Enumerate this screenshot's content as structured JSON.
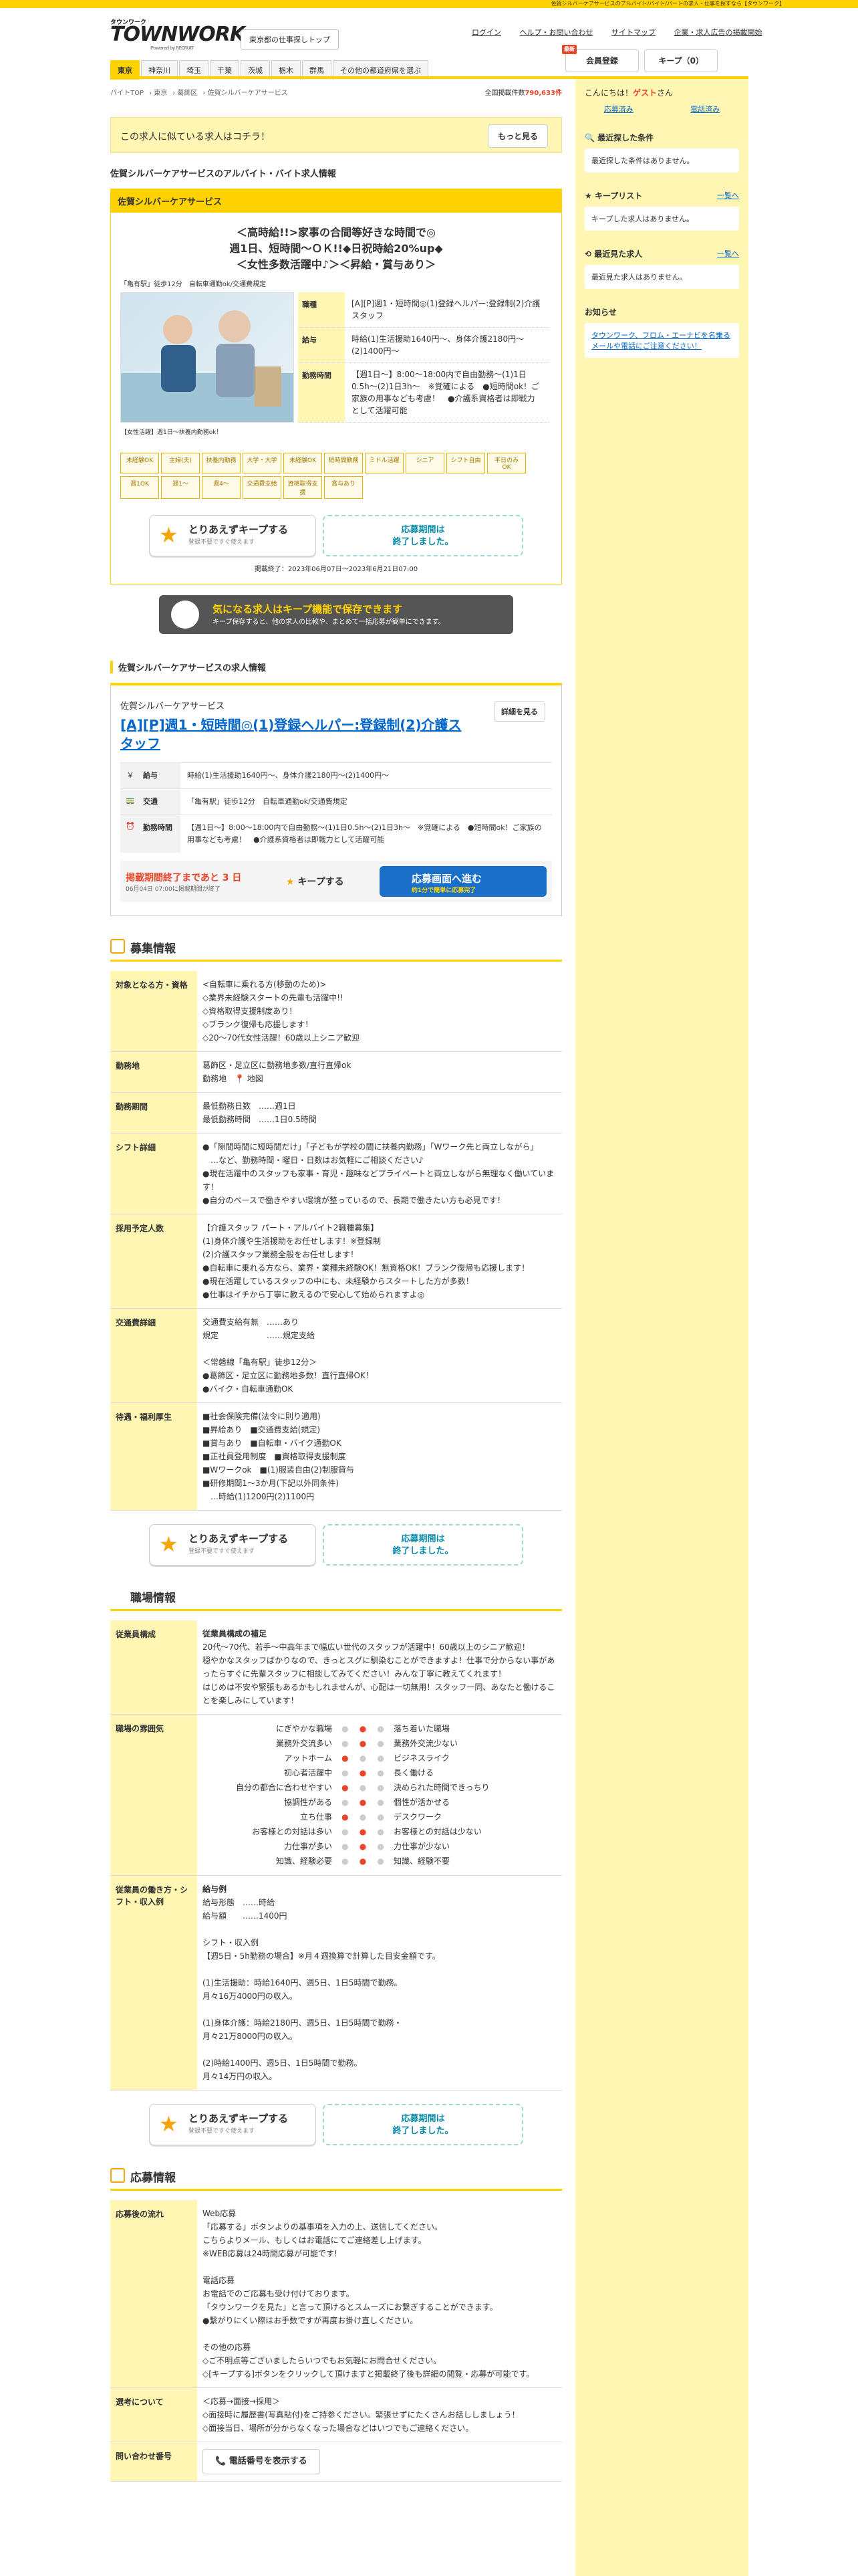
{
  "topbar": {
    "text": "佐賀シルバーケアサービスのアルバイト/バイト/パートの求人・仕事を探すなら【タウンワーク】"
  },
  "header": {
    "logo_top": "タウンワーク",
    "logo": "TOWNWORK",
    "logo_sub": "Powered by RECRUIT",
    "area_btn": "東京都の仕事探しトップ",
    "links": [
      "ログイン",
      "ヘルプ・お問い合わせ",
      "サイトマップ",
      "企業・求人広告の掲載開始"
    ],
    "register": "会員登録",
    "register_badge": "最新",
    "keep": "キープ（0）"
  },
  "tabs": [
    "東京",
    "神奈川",
    "埼玉",
    "千葉",
    "茨城",
    "栃木",
    "群馬",
    "その他の都道府県を選ぶ"
  ],
  "breadcrumb": [
    "バイトTOP",
    "東京",
    "葛飾区",
    "佐賀シルバーケアサービス"
  ],
  "count": {
    "label": "全国掲載件数",
    "value": "790,633件"
  },
  "promo": {
    "text": "この求人に似ている求人はコチラ！",
    "more": "もっと見る"
  },
  "page_title": "佐賀シルバーケアサービスのアルバイト・バイト求人情報",
  "card": {
    "company": "佐賀シルバーケアサービス",
    "catch": [
      "＜高時給!!>家事の合間等好きな時間で◎",
      "週1日、短時間～ＯＫ!!◆日祝時給20%up◆",
      "＜女性多数活躍中♪＞＜昇給・賞与あり＞"
    ],
    "access": "「亀有駅」徒歩12分　自転車通勤ok/交通費規定",
    "photo_caption": "【女性活躍】週1日～扶養内勤務ok！",
    "info": [
      {
        "k": "職種",
        "v": "[A][P]週1・短時間◎(1)登録ヘルパー:登録制(2)介護スタッフ"
      },
      {
        "k": "給与",
        "v": "時給(1)生活援助1640円～、身体介護2180円～(2)1400円～"
      },
      {
        "k": "勤務時間",
        "v": "【週1日～】8:00～18:00内で自由勤務～(1)1日0.5h～(2)1日3h～　※覚確による　●短時間ok！ご家族の用事なども考慮！　●介護系資格者は即戦力として活躍可能"
      }
    ],
    "tags": [
      "未経験OK",
      "主婦(夫)",
      "扶養内勤務",
      "大学・大学",
      "未経験OK",
      "短時間勤務",
      "ミドル活躍",
      "シニア",
      "シフト自由",
      "平日のみOK",
      "週1OK",
      "週1～",
      "週4～",
      "交通費支給",
      "資格取得支援",
      "賞与あり"
    ],
    "keep_title": "とりあえずキープする",
    "keep_sub": "登録不要ですぐ使えます",
    "closed": [
      "応募期間は",
      "終了しました。"
    ],
    "pubdate": "掲載終了：2023年06月07日～2023年6月21日07:00"
  },
  "banner": {
    "title": "気になる求人はキープ機能で保存できます",
    "sub": "キープ保存すると、他の求人の比較や、まとめて一括応募が簡単にできます。"
  },
  "list": {
    "heading": "佐賀シルバーケアサービスの求人情報",
    "company": "佐賀シルバーケアサービス",
    "title": "[A][P]週1・短時間◎(1)登録ヘルパー:登録制(2)介護スタッフ",
    "detail": "詳細を見る",
    "rows": [
      {
        "icon": "￥",
        "k": "給与",
        "v": "時給(1)生活援助1640円～、身体介護2180円～(2)1400円～"
      },
      {
        "icon": "🚃",
        "k": "交通",
        "v": "「亀有駅」徒歩12分　自転車通勤ok/交通費規定"
      },
      {
        "icon": "⏰",
        "k": "勤務時間",
        "v": "【週1日～】8:00～18:00内で自由勤務～(1)1日0.5h～(2)1日3h～　※覚確による　●短時間ok！ご家族の用事なども考慮！　●介護系資格者は即戦力として活躍可能"
      }
    ],
    "deadline": "掲載期間終了まであと 3 日",
    "deadline_sub": "06月04日 07:00に掲載期間が終了",
    "keep": "キープする",
    "apply": "応募画面へ進む",
    "apply_sub": "約1分で簡単に応募完了"
  },
  "recruit": {
    "heading": "募集情報",
    "rows": [
      {
        "k": "対象となる方・資格",
        "v": [
          "<自転車に乗れる方(移動のため)>",
          "◇業界未経験スタートの先輩も活躍中!!",
          "◇資格取得支援制度あり！",
          "◇ブランク復帰も応援します！",
          "◇20～70代女性活躍！60歳以上シニア歓迎"
        ]
      },
      {
        "k": "勤務地",
        "v": [
          "葛飾区・足立区に勤務地多数/直行直帰ok",
          "勤務地　📍 地図"
        ]
      },
      {
        "k": "勤務期間",
        "v": [
          "最低勤務日数　……週1日",
          "最低勤務時間　……1日0.5時間"
        ]
      },
      {
        "k": "シフト詳細",
        "v": [
          "●「隙間時間に短時間だけ」「子どもが学校の間に扶養内勤務」「Wワーク先と両立しながら」",
          "　…など、勤務時間・曜日・日数はお気軽にご相談ください♪",
          "●現在活躍中のスタッフも家事・育児・趣味などプライベートと両立しながら無理なく働いています！",
          "●自分のペースで働きやすい環境が整っているので、長期で働きたい方も必見です！"
        ]
      },
      {
        "k": "採用予定人数",
        "v": [
          "【介護スタッフ パート・アルバイト2職種募集】",
          "(1)身体介護や生活援助をお任せします！※登録制",
          "(2)介護スタッフ業務全般をお任せします！",
          "●自転車に乗れる方なら、業界・業種未経験OK！無資格OK！ブランク復帰も応援します！",
          "●現在活躍しているスタッフの中にも、未経験からスタートした方が多数！",
          "●仕事はイチから丁寧に教えるので安心して始められますよ◎"
        ]
      },
      {
        "k": "交通費詳細",
        "v": [
          "交通費支給有無　……あり",
          "規定　　　　　　……規定支給",
          "",
          "＜常磐線「亀有駅」徒歩12分＞",
          "●葛飾区・足立区に勤務地多数！直行直帰OK！",
          "●バイク・自転車通勤OK"
        ]
      },
      {
        "k": "待遇・福利厚生",
        "v": [
          "■社会保険完備(法令に則り適用)",
          "■昇給あり　■交通費支給(規定)",
          "■賞与あり　■自転車・バイク通勤OK",
          "■正社員登用制度　■資格取得支援制度",
          "■Wワークok　■(1)服装自由(2)制服貸与",
          "■研修期間1～3か月(下記以外同条件)",
          "　…時給(1)1200円(2)1100円"
        ]
      }
    ]
  },
  "workplace": {
    "heading": "職場情報",
    "rows": [
      {
        "k": "従業員構成",
        "v": [
          "従業員構成の補足",
          "20代～70代、若手～中高年まで幅広い世代のスタッフが活躍中！60歳以上のシニア歓迎！",
          "穏やかなスタッフばかりなので、きっとスグに馴染むことができますよ！仕事で分からない事があったらすぐに先輩スタッフに相談してみてください！みんな丁寧に教えてくれます！",
          "はじめは不安や緊張もあるかもしれませんが、心配は一切無用！スタッフ一同、あなたと働けることを楽しみにしています！"
        ]
      },
      {
        "k": "職場の雰囲気",
        "scale": [
          [
            "にぎやかな職場",
            "落ち着いた職場",
            1
          ],
          [
            "業務外交流多い",
            "業務外交流少ない",
            1
          ],
          [
            "アットホーム",
            "ビジネスライク",
            0
          ],
          [
            "初心者活躍中",
            "長く働ける",
            1
          ],
          [
            "自分の都合に合わせやすい",
            "決められた時間できっちり",
            0
          ],
          [
            "協調性がある",
            "個性が活かせる",
            1
          ],
          [
            "立ち仕事",
            "デスクワーク",
            0
          ],
          [
            "お客様との対話は多い",
            "お客様との対話は少ない",
            1
          ],
          [
            "力仕事が多い",
            "力仕事が少ない",
            1
          ],
          [
            "知識、経験必要",
            "知識、経験不要",
            1
          ]
        ]
      },
      {
        "k": "従業員の働き方・シフト・収入例",
        "v": [
          "給与例",
          "給与形態　……時給",
          "給与額　　……1400円",
          "",
          "シフト・収入例",
          "【週5日・5h勤務の場合】※月４週換算で計算した目安金額です。",
          "",
          "(1)生活援助：時給1640円、週5日、1日5時間で勤務。",
          "月々16万4000円の収入。",
          "",
          "(1)身体介護：時給2180円、週5日、1日5時間で勤務・",
          "月々21万8000円の収入。",
          "",
          "(2)時給1400円、週5日、1日5時間で勤務。",
          "月々14万円の収入。"
        ]
      }
    ]
  },
  "apply": {
    "heading": "応募情報",
    "rows": [
      {
        "k": "応募後の流れ",
        "v": [
          "Web応募",
          "「応募する」ボタンよりの基事項を入力の上、送信してください。",
          "こちらよりメール、もしくはお電話にてご連絡差し上げます。",
          "※WEB応募は24時間応募が可能です!",
          "",
          "電話応募",
          "お電話でのご応募も受け付けております。",
          "「タウンワークを見た」と言って頂けるとスムーズにお繋ぎすることができます。",
          "●繋がりにくい際はお手数ですが再度お掛け直しください。",
          "",
          "その他の応募",
          "◇ご不明点等ございましたらいつでもお気軽にお問合せください。",
          "◇[キープする]ボタンをクリックして頂けますと掲載終了後も詳細の閲覧・応募が可能です。"
        ]
      },
      {
        "k": "選考について",
        "v": [
          "＜応募→面接→採用＞",
          "◇面接時に履歴書(写真貼付)をご持参ください。緊張せずにたくさんお話ししましょう！",
          "◇面接当日、場所が分からなくなった場合などはいつでもご連絡ください。"
        ]
      },
      {
        "k": "問い合わせ番号",
        "tel": "電話番号を表示する"
      }
    ]
  },
  "side": {
    "greet": "こんにちは！",
    "guest": "ゲスト",
    "san": "さん",
    "links": [
      "応募済み",
      "電話済み"
    ],
    "recent_cond": "最近探した条件",
    "recent_cond_empty": "最近探した条件はありません。",
    "keep_list": "キープリスト",
    "list_link": "一覧へ",
    "keep_empty": "キープした求人はありません。",
    "recent_jobs": "最近見た求人",
    "recent_empty": "最近見た求人はありません。",
    "notice": "お知らせ",
    "notice_text": "タウンワーク、フロム・エーナビを名乗るメールや電話にご注意ください！"
  }
}
